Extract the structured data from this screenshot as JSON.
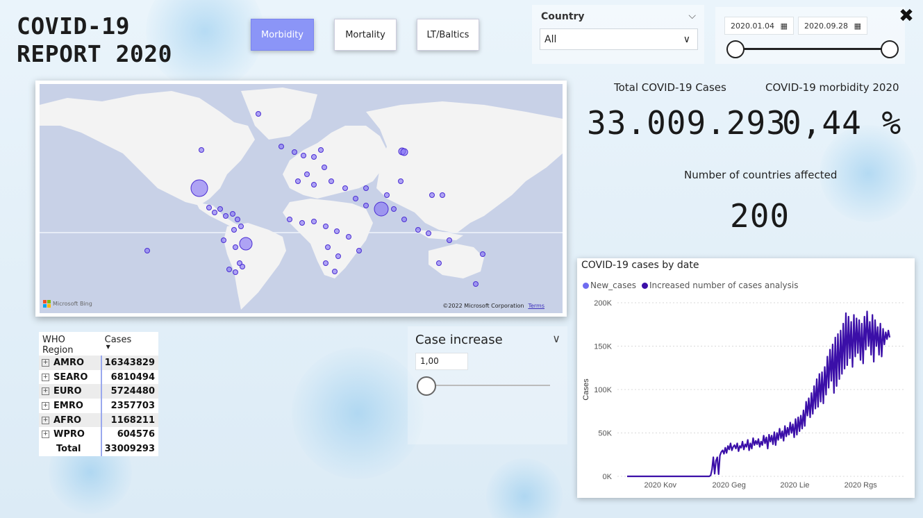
{
  "report": {
    "title": "COVID-19\nREPORT 2020"
  },
  "nav": [
    {
      "label": "Morbidity",
      "active": true
    },
    {
      "label": "Mortality",
      "active": false
    },
    {
      "label": "LT/Baltics",
      "active": false
    }
  ],
  "country_filter": {
    "label": "Country",
    "value": "All"
  },
  "date_filter": {
    "start": "2020.01.04",
    "end": "2020.09.28"
  },
  "map": {
    "provider": "Microsoft Bing",
    "copyright": "©2022 Microsoft Corporation",
    "terms": "Terms"
  },
  "kpis": {
    "total_cases_label": "Total COVID-19 Cases",
    "total_cases_value": "33.009.293",
    "morbidity_label": "COVID-19 morbidity 2020",
    "morbidity_value": "0,44 %",
    "countries_label": "Number of countries affected",
    "countries_value": "200"
  },
  "region_table": {
    "headers": [
      "WHO Region",
      "Cases"
    ],
    "rows": [
      {
        "region": "AMRO",
        "cases": "16343829"
      },
      {
        "region": "SEARO",
        "cases": "6810494"
      },
      {
        "region": "EURO",
        "cases": "5724480"
      },
      {
        "region": "EMRO",
        "cases": "2357703"
      },
      {
        "region": "AFRO",
        "cases": "1168211"
      },
      {
        "region": "WPRO",
        "cases": "604576"
      }
    ],
    "total_label": "Total",
    "total_value": "33009293"
  },
  "case_increase": {
    "label": "Case increase",
    "value": "1,00"
  },
  "colors": {
    "accent": "#8b95f7",
    "new_cases": "#6f6bf0",
    "increase_analysis": "#3b0fa8",
    "bubble": "#806ef5"
  },
  "chart_data": {
    "type": "line",
    "title": "COVID-19 cases by date",
    "ylabel": "Cases",
    "xlabel": "",
    "legend": [
      "New_cases",
      "Increased number of cases analysis"
    ],
    "legend_position": "top-left",
    "x_ticks": [
      "2020 Kov",
      "2020 Geg",
      "2020 Lie",
      "2020 Rgs"
    ],
    "y_ticks": [
      "0K",
      "50K",
      "100K",
      "150K",
      "200K"
    ],
    "ylim": [
      0,
      200000
    ],
    "grid": true,
    "series": [
      {
        "name": "Increased number of cases analysis",
        "values": [
          0,
          0,
          0,
          0,
          0,
          0,
          0,
          0,
          0,
          0,
          0,
          0,
          0,
          0,
          0,
          0,
          0,
          0,
          0,
          0,
          0,
          0,
          0,
          0,
          0,
          0,
          0,
          0,
          0,
          0,
          0,
          0,
          0,
          0,
          0,
          0,
          0,
          0,
          0,
          0,
          0,
          0,
          0,
          0,
          0,
          0,
          0,
          0,
          0,
          0,
          0,
          0,
          0,
          0,
          0,
          0,
          0,
          0,
          0,
          0,
          0,
          0,
          0,
          1200,
          8000,
          22000,
          3000,
          18000,
          22000,
          2500,
          24000,
          28000,
          30000,
          26000,
          33000,
          27000,
          35000,
          31000,
          38000,
          30000,
          34000,
          36000,
          32000,
          38000,
          29000,
          35000,
          33000,
          40000,
          31000,
          37000,
          34000,
          42000,
          30000,
          38000,
          32000,
          44000,
          36000,
          41000,
          37000,
          43000,
          34000,
          40000,
          36000,
          47000,
          38000,
          45000,
          32000,
          48000,
          40000,
          47000,
          37000,
          51000,
          36000,
          50000,
          42000,
          55000,
          44000,
          52000,
          41000,
          58000,
          46000,
          56000,
          48000,
          62000,
          50000,
          60000,
          45000,
          66000,
          48000,
          68000,
          52000,
          70000,
          55000,
          76000,
          58000,
          86000,
          70000,
          90000,
          68000,
          96000,
          72000,
          104000,
          78000,
          112000,
          80000,
          118000,
          86000,
          120000,
          84000,
          126000,
          94000,
          138000,
          102000,
          146000,
          110000,
          152000,
          96000,
          160000,
          104000,
          164000,
          112000,
          168000,
          118000,
          176000,
          124000,
          188000,
          128000,
          184000,
          136000,
          178000,
          126000,
          186000,
          138000,
          182000,
          142000,
          180000,
          134000,
          176000,
          130000,
          184000,
          146000,
          190000,
          150000,
          178000,
          140000,
          186000,
          132000,
          180000,
          150000,
          172000,
          140000,
          176000,
          138000,
          170000,
          152000,
          166000,
          158000,
          168000,
          160000
        ]
      }
    ]
  }
}
